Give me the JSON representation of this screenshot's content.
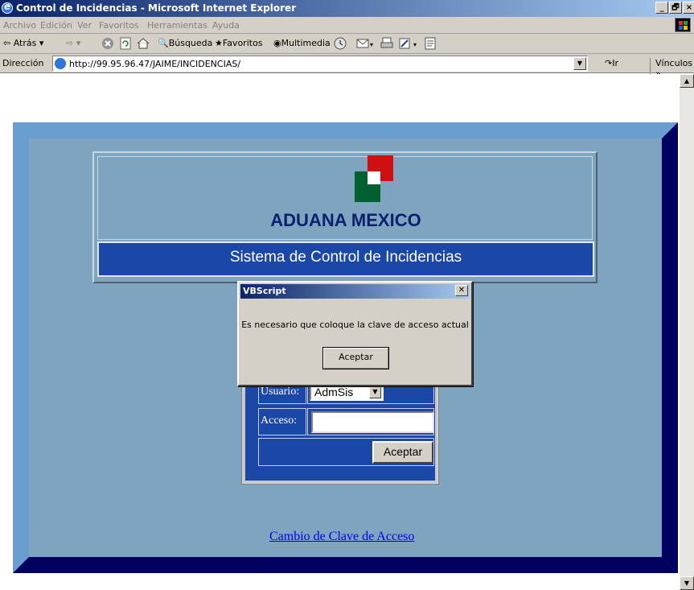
{
  "window": {
    "title": "Control de Incidencias - Microsoft Internet Explorer",
    "controls": {
      "minimize": "_",
      "maximize": "🗗",
      "close": "×"
    }
  },
  "menubar": {
    "items": [
      "Archivo",
      "Edición",
      "Ver",
      "Favoritos",
      "Herramientas",
      "Ayuda"
    ]
  },
  "toolbar": {
    "back": "Atrás",
    "search": "Búsqueda",
    "favorites": "Favoritos",
    "media": "Multimedia"
  },
  "address": {
    "label": "Dirección",
    "url": "http://99.95.96.47/JAIME/INCIDENCIAS/",
    "go": "Ir",
    "links": "Vínculos"
  },
  "page": {
    "brand": "ADUANA MEXICO",
    "system_title": "Sistema de Control de Incidencias",
    "login": {
      "user_label": "Usuario:",
      "user_value": "AdmSis",
      "access_label": "Acceso:",
      "access_value": "",
      "submit_label": "Aceptar"
    },
    "change_password_link": "Cambio de Clave de Acceso"
  },
  "dialog": {
    "title": "VBScript",
    "message": "Es necesario que coloque la clave de acceso actual",
    "ok_label": "Aceptar"
  },
  "colors": {
    "frame_blue": "#6a9ed0",
    "band_blue": "#1a47a8",
    "brand_text": "#0a1f6e"
  }
}
